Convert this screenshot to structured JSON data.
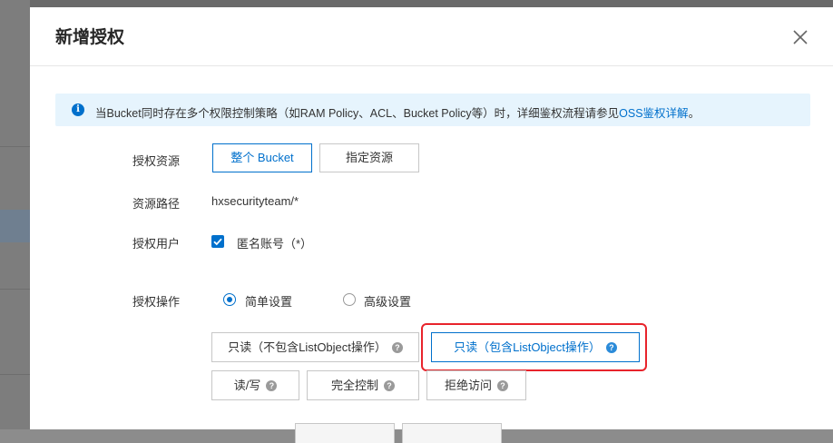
{
  "dialog": {
    "title": "新增授权"
  },
  "notice": {
    "icon": "info-icon",
    "text": "当Bucket同时存在多个权限控制策略（如RAM Policy、ACL、Bucket Policy等）时，详细鉴权流程请参见",
    "link": "OSS鉴权详解",
    "suffix": "。"
  },
  "form": {
    "resource_label": "授权资源",
    "resource_options": [
      "整个 Bucket",
      "指定资源"
    ],
    "resource_selected": "整个 Bucket",
    "path_label": "资源路径",
    "path_value": "hxsecurityteam/*",
    "user_label": "授权用户",
    "user_checkbox_label": "匿名账号（*）",
    "user_checked": true,
    "action_label": "授权操作",
    "action_modes": [
      "简单设置",
      "高级设置"
    ],
    "action_mode_selected": "简单设置",
    "permissions": [
      "只读（不包含ListObject操作）",
      "只读（包含ListObject操作）",
      "读/写",
      "完全控制",
      "拒绝访问"
    ],
    "permission_selected": "只读（包含ListObject操作）"
  },
  "colors": {
    "accent": "#0070cc",
    "notice_bg": "#e6f4fd",
    "highlight_outline": "#e8242c"
  }
}
